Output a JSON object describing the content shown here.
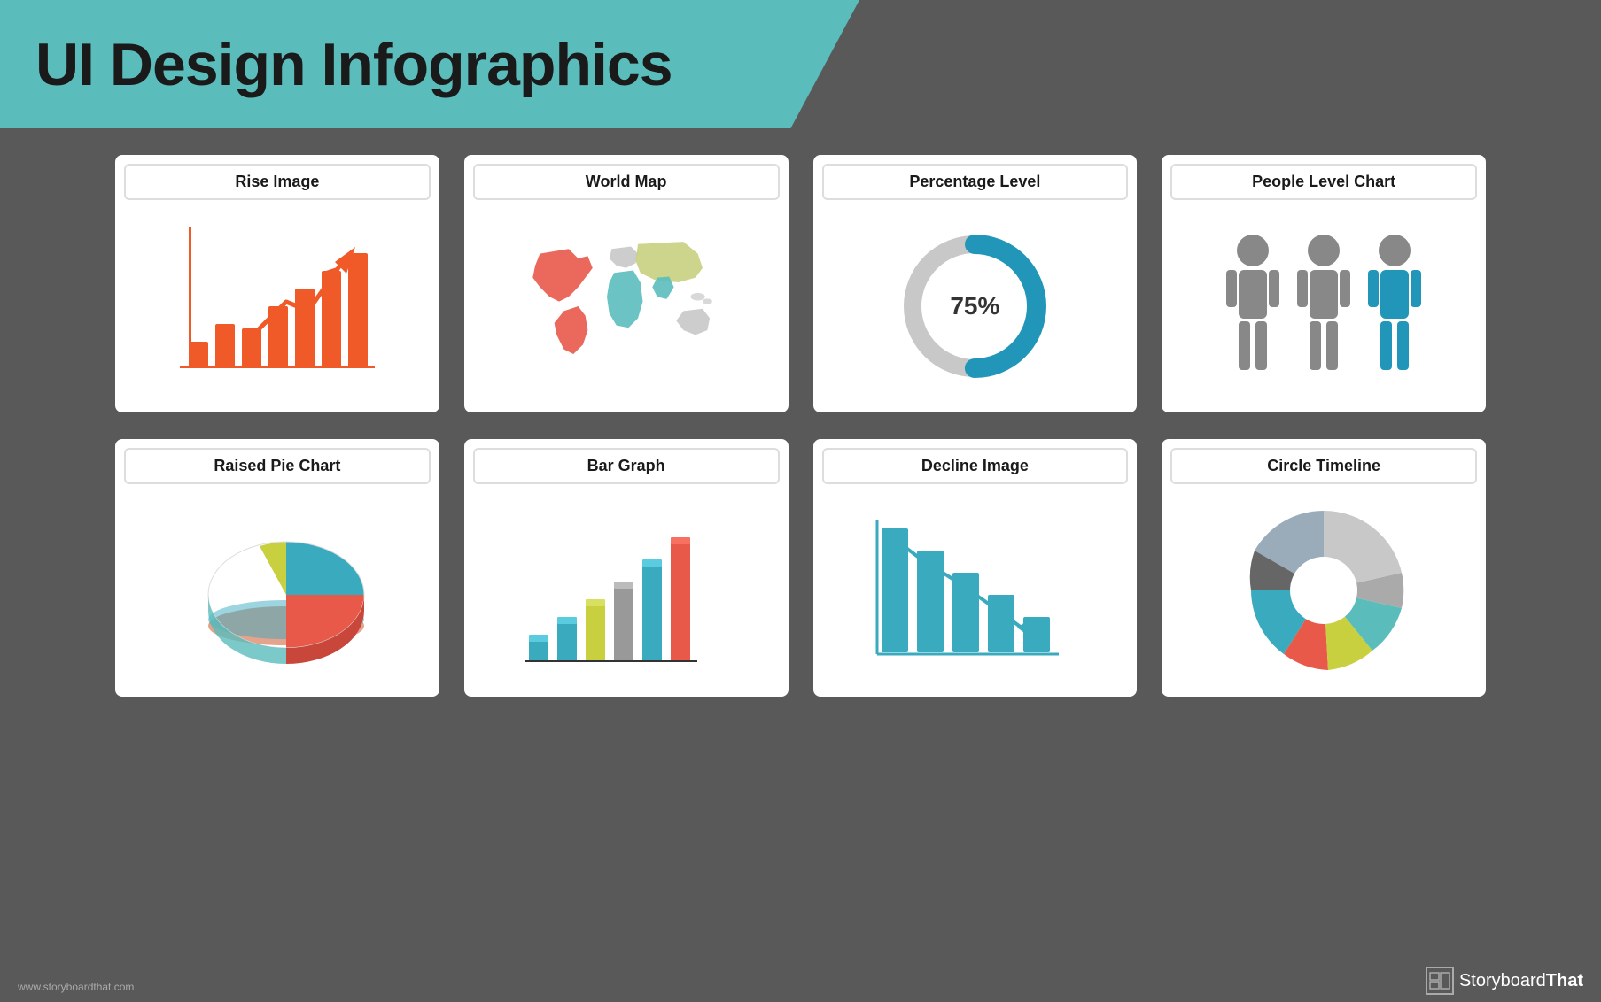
{
  "header": {
    "title": "UI Design Infographics",
    "background_color": "#5bbcbc"
  },
  "cards": [
    {
      "id": "rise-image",
      "title": "Rise Image",
      "row": 1,
      "col": 1
    },
    {
      "id": "world-map",
      "title": "World Map",
      "row": 1,
      "col": 2
    },
    {
      "id": "percentage-level",
      "title": "Percentage Level",
      "row": 1,
      "col": 3
    },
    {
      "id": "people-level-chart",
      "title": "People Level Chart",
      "row": 1,
      "col": 4
    },
    {
      "id": "raised-pie-chart",
      "title": "Raised Pie Chart",
      "row": 2,
      "col": 1
    },
    {
      "id": "bar-graph",
      "title": "Bar Graph",
      "row": 2,
      "col": 2
    },
    {
      "id": "decline-image",
      "title": "Decline Image",
      "row": 2,
      "col": 3
    },
    {
      "id": "circle-timeline",
      "title": "Circle Timeline",
      "row": 2,
      "col": 4
    }
  ],
  "percentage": {
    "value": "75%"
  },
  "footer": {
    "website": "www.storyboardthat.com",
    "brand": "StoryboardThat"
  }
}
